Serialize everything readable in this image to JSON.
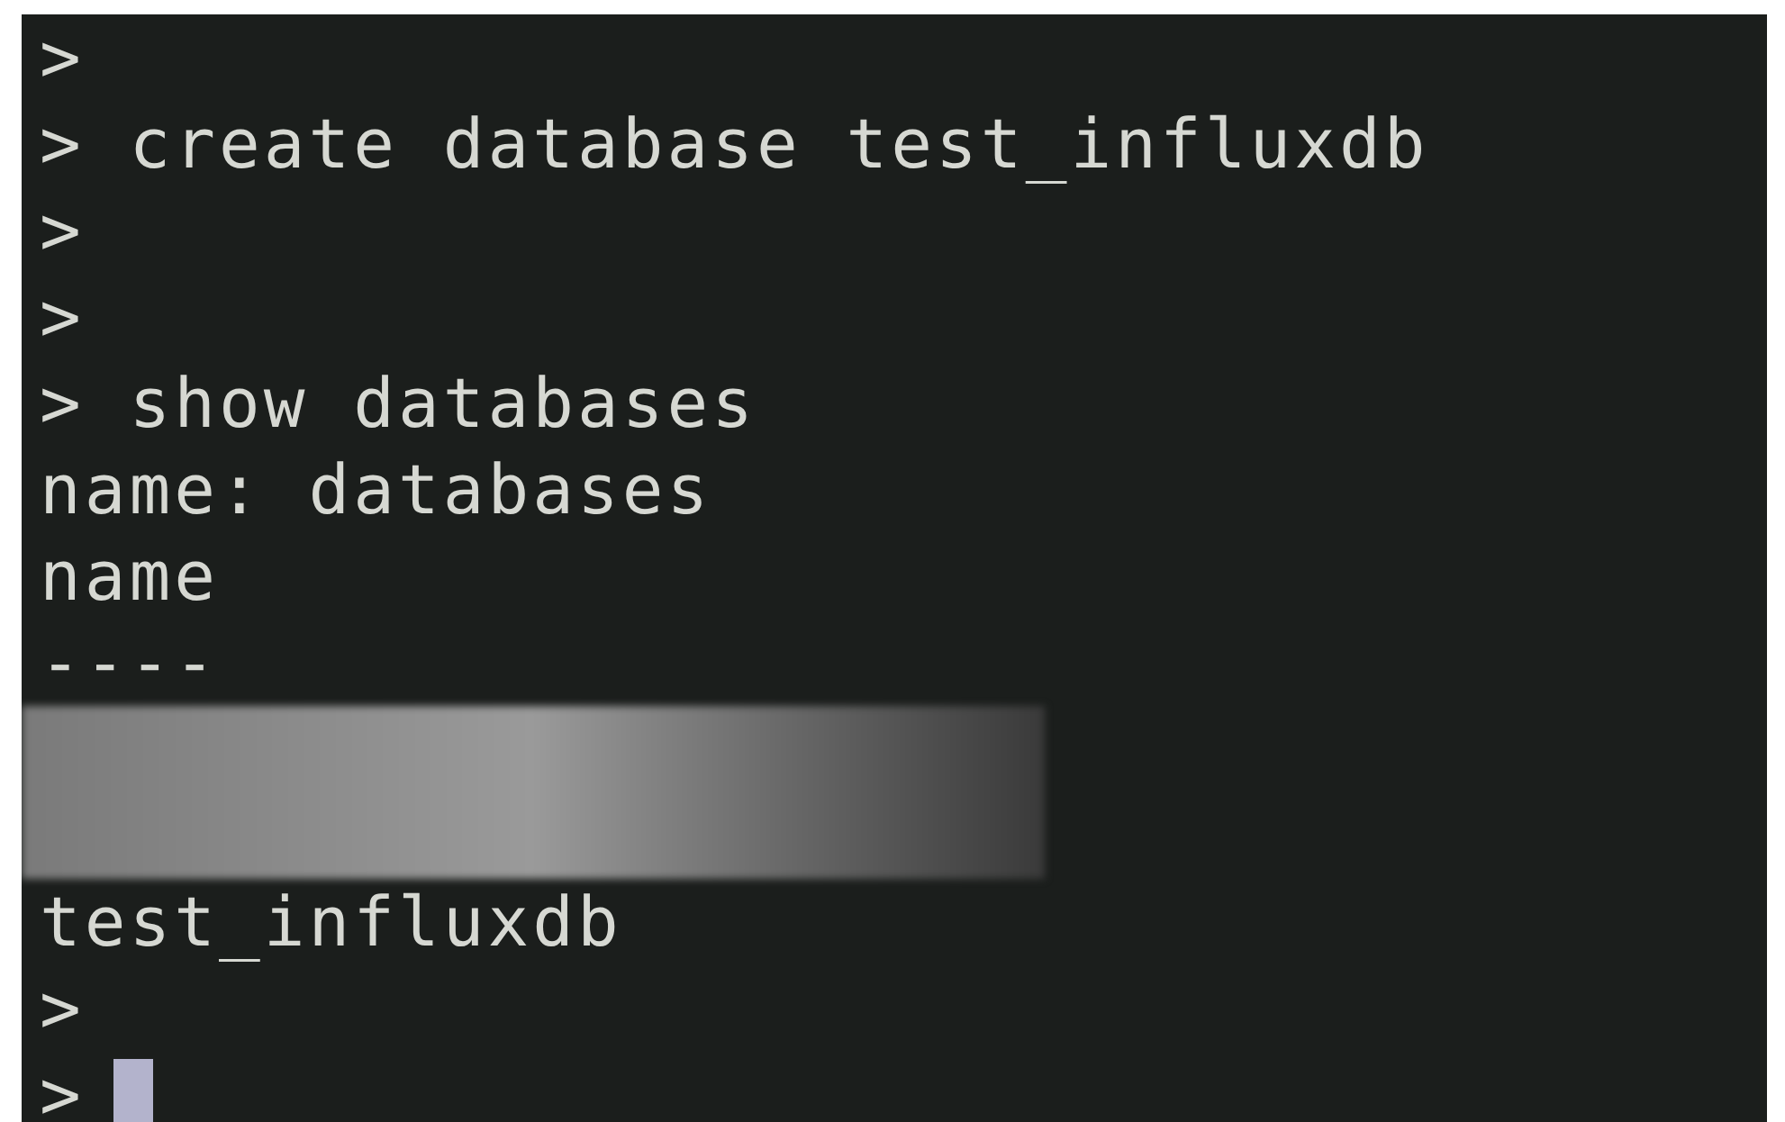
{
  "terminal": {
    "lines": [
      {
        "kind": "text",
        "text": ">"
      },
      {
        "kind": "text",
        "text": "> create database test_influxdb"
      },
      {
        "kind": "text",
        "text": ">"
      },
      {
        "kind": "text",
        "text": ">"
      },
      {
        "kind": "text",
        "text": "> show databases"
      },
      {
        "kind": "text",
        "text": "name: databases"
      },
      {
        "kind": "text",
        "text": "name"
      },
      {
        "kind": "text",
        "text": "----"
      },
      {
        "kind": "redacted"
      },
      {
        "kind": "text",
        "text": "test_influxdb"
      },
      {
        "kind": "text",
        "text": ">"
      },
      {
        "kind": "input",
        "text": ">",
        "cursor": true
      }
    ]
  }
}
